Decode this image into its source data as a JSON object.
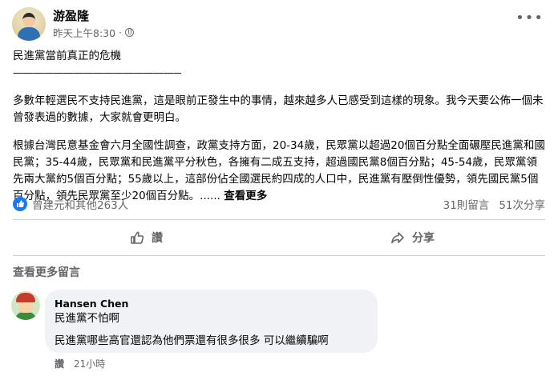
{
  "post": {
    "author": "游盈隆",
    "timestamp": "昨天上午8:30",
    "dot": "·",
    "more_icon": "more-horizontal-icon",
    "headline": "民進黨當前真正的危機",
    "rule": "——————————————————————",
    "paragraph1": "多數年輕選民不支持民進黨，這是眼前正發生中的事情，越來越多人已感受到這樣的現象。我今天要公佈一個未曾發表過的數據，大家就會更明白。",
    "paragraph2": "根據台灣民意基金會六月全國性調查，政黨支持方面，20-34歲，民眾黨以超過20個百分點全面碾壓民進黨和國民黨；35-44歲，民眾黨和民進黨平分秋色，各擁有二成五支持，超過國民黨8個百分點；45-54歲，民眾黨領先兩大黨約5個百分點；55歲以上，這部份佔全國選民約四成的人口中，民進黨有壓倒性優勢，領先國民黨5個百分點，領先民眾黨至少20個百分點。......",
    "see_more": "查看更多"
  },
  "stats": {
    "likes": "曾建元和其他263人",
    "comments": "31則留言",
    "shares": "51次分享",
    "accent_color": "#1877f2"
  },
  "actions": {
    "like": "讚",
    "share": "分享"
  },
  "comments_section": {
    "view_more": "查看更多留言",
    "comment": {
      "name": "Hansen Chen",
      "line1": "民進黨不怕啊",
      "line2": "民進黨哪些高官還認為他們票還有很多很多 可以繼續騙啊",
      "like": "讚",
      "time": "21小時"
    }
  }
}
